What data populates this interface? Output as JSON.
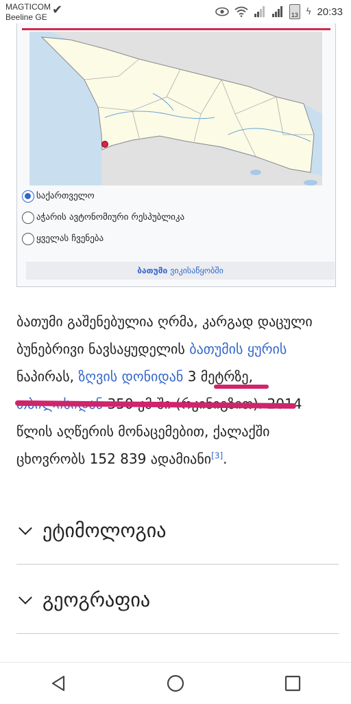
{
  "status_bar": {
    "carrier_1": "MAGTICOM",
    "carrier_2": "Beeline GE",
    "battery": "13",
    "time": "20:33"
  },
  "infobox": {
    "radio_options": [
      {
        "label": "საქართველო",
        "checked": true
      },
      {
        "label": "აჭარის ავტონომიური რესპუბლიკა",
        "checked": false
      },
      {
        "label": "ყველას ჩვენება",
        "checked": false
      }
    ],
    "wiki_link": {
      "bold": "ბათუმი",
      "rest": "ვიკისაწყობში"
    }
  },
  "paragraph": {
    "t1": "ბათუმი გაშენებულია ღრმა, კარგად დაცული ბუნებრივი ნავსაყუდელის ",
    "l1": "ბათუმის ყურის",
    "t2": " ნაპირას, ",
    "l2": "ზღვის დონიდან",
    "t3": " 3 მეტრზე, ",
    "l3": "თბილისიდან",
    "t4": " 350 კმ-ში (რკინიგზით). 2014 წლის აღწერის მონაცემებით, ქალაქში ცხოვრობს 152 839 ადამიანი",
    "ref": "[3]",
    "t5": "."
  },
  "sections": [
    {
      "title": "ეტიმოლოგია"
    },
    {
      "title": "გეოგრაფია"
    }
  ],
  "colors": {
    "link": "#3366cc",
    "marker_red": "#d4264e",
    "annotation_pink": "#d0246b"
  }
}
